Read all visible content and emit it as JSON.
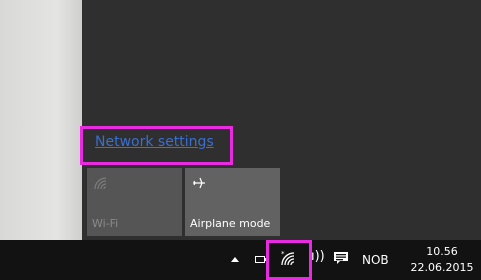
{
  "network_flyout": {
    "settings_link": "Network settings"
  },
  "quick_actions": [
    {
      "label": "Wi-Fi",
      "icon": "wifi-off-icon",
      "state": "off"
    },
    {
      "label": "Airplane mode",
      "icon": "airplane-icon",
      "state": "available"
    }
  ],
  "taskbar": {
    "language": "NOB",
    "time": "10.56",
    "date": "22.06.2015"
  },
  "colors": {
    "highlight": "#e82be0",
    "link": "#3a6fd0"
  }
}
